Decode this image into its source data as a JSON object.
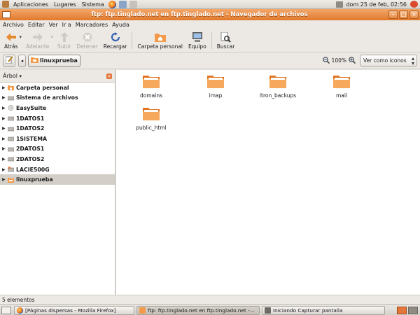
{
  "top_panel": {
    "menus": [
      "Aplicaciones",
      "Lugares",
      "Sistema"
    ],
    "clock": "dom 25 de feb, 02:56"
  },
  "window": {
    "title": "ftp: ftp.tinglado.net en ftp.tinglado.net - Navegador de archivos"
  },
  "menubar": [
    "Archivo",
    "Editar",
    "Ver",
    "Ir a",
    "Marcadores",
    "Ayuda"
  ],
  "toolbar": {
    "back": "Atrás",
    "forward": "Adelante",
    "up": "Subir",
    "stop": "Detener",
    "reload": "Recargar",
    "home": "Carpeta personal",
    "computer": "Equipo",
    "search": "Buscar"
  },
  "location": {
    "path_label": "linuxprueba",
    "zoom": "100%",
    "view_mode": "Ver como iconos"
  },
  "sidepane": {
    "header": "Árbol",
    "items": [
      {
        "label": "Carpeta personal",
        "icon": "home-folder-icon"
      },
      {
        "label": "Sistema de archivos",
        "icon": "drive-icon"
      },
      {
        "label": "EasySuite",
        "icon": "disc-icon"
      },
      {
        "label": "1DATOS1",
        "icon": "drive-icon"
      },
      {
        "label": "1DATOS2",
        "icon": "drive-icon"
      },
      {
        "label": "1SISTEMA",
        "icon": "drive-icon"
      },
      {
        "label": "2DATOS1",
        "icon": "drive-icon"
      },
      {
        "label": "2DATOS2",
        "icon": "drive-icon"
      },
      {
        "label": "LACIE500G",
        "icon": "usb-drive-icon"
      },
      {
        "label": "linuxprueba",
        "icon": "network-folder-icon"
      }
    ]
  },
  "files": [
    {
      "name": "domains"
    },
    {
      "name": "imap"
    },
    {
      "name": "itron_backups"
    },
    {
      "name": "mail"
    },
    {
      "name": "public_html"
    }
  ],
  "status": "5 elementos",
  "taskbar": [
    {
      "label": "[Páginas dispersas - Mozilla Firefox]"
    },
    {
      "label": "ftp: ftp.tinglado.net en ftp.tinglado.net -..."
    },
    {
      "label": "Iniciando Capturar pantalla"
    }
  ],
  "colors": {
    "titlebar": "#e58a44",
    "folder": "#f39b4a",
    "selected_row": "#d3cfc8"
  }
}
